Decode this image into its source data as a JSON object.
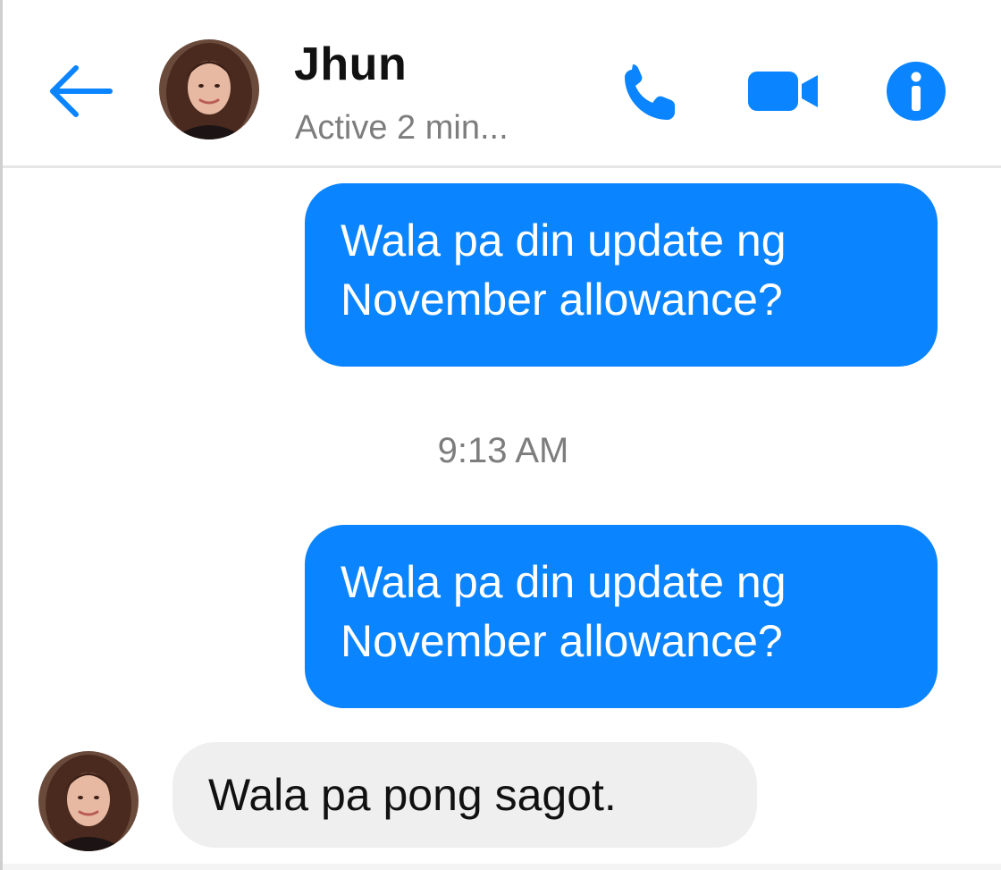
{
  "header": {
    "contact_name": "Jhun",
    "status": "Active 2 min...",
    "back_icon": "arrow-left-icon",
    "call_icon": "phone-icon",
    "video_icon": "video-camera-icon",
    "info_icon": "info-icon"
  },
  "messages": [
    {
      "direction": "outgoing",
      "lines": [
        "Wala pa din update ng",
        "November allowance?"
      ]
    },
    {
      "type": "timestamp",
      "text": "9:13 AM"
    },
    {
      "direction": "outgoing",
      "lines": [
        "Wala pa din update ng",
        "November allowance?"
      ]
    },
    {
      "direction": "incoming",
      "lines": [
        "Wala pa pong sagot."
      ]
    }
  ],
  "colors": {
    "accent": "#0a84ff",
    "outgoing_bubble": "#0a84ff",
    "incoming_bubble": "#efefef",
    "secondary_text": "#7d7d7d"
  }
}
